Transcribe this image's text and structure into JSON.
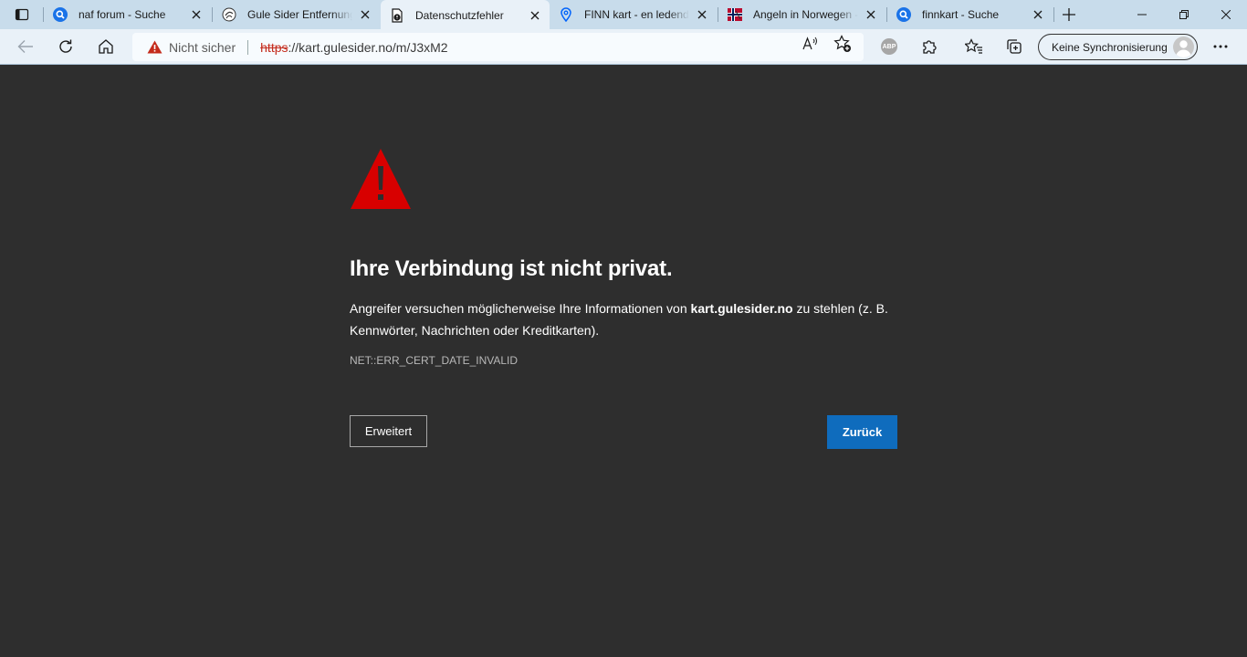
{
  "tabs": [
    {
      "title": "naf forum - Suche",
      "icon": "search-favicon-icon",
      "active": false
    },
    {
      "title": "Gule Sider Entfernung",
      "icon": "gulesider-favicon-icon",
      "active": false
    },
    {
      "title": "Datenschutzfehler",
      "icon": "error-document-favicon-icon",
      "active": true
    },
    {
      "title": "FINN kart - en ledende",
      "icon": "map-pin-favicon-icon",
      "active": false
    },
    {
      "title": "Angeln in Norwegen -",
      "icon": "norway-flag-favicon-icon",
      "active": false
    },
    {
      "title": "finnkart - Suche",
      "icon": "search-favicon-icon",
      "active": false
    }
  ],
  "address": {
    "security_label": "Nicht sicher",
    "scheme": "https",
    "rest": "://kart.gulesider.no/m/J3xM2"
  },
  "extensions": {
    "adblock_label": "ABP"
  },
  "profile": {
    "sync_label": "Keine Synchronisierung"
  },
  "error": {
    "heading": "Ihre Verbindung ist nicht privat.",
    "desc_before": "Angreifer versuchen möglicherweise Ihre Informationen von ",
    "host": "kart.gulesider.no",
    "desc_after": " zu stehlen (z. B. Kennwörter, Nachrichten oder Kreditkarten).",
    "code": "NET::ERR_CERT_DATE_INVALID",
    "advanced_label": "Erweitert",
    "back_label": "Zurück"
  },
  "colors": {
    "tabstrip": "#c8dceb",
    "toolbar": "#e9f1f8",
    "page_background": "#2e2e2e",
    "warning_red": "#c42b1c",
    "error_icon_red": "#d80000",
    "primary_button": "#0f6cbd"
  }
}
